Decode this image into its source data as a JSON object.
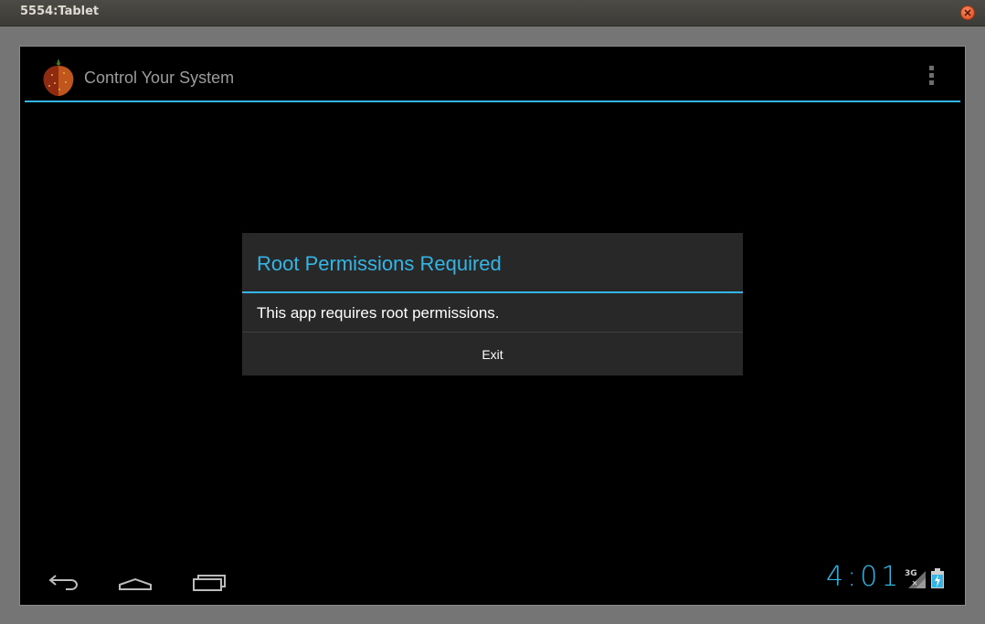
{
  "window": {
    "title": "5554:Tablet"
  },
  "app": {
    "title": "Control Your System",
    "icon": "strawberry-icon"
  },
  "dialog": {
    "title": "Root Permissions Required",
    "message": "This app requires root permissions.",
    "button_label": "Exit"
  },
  "status": {
    "time": "4:01",
    "network": "3G"
  },
  "colors": {
    "accent": "#33b5e5",
    "dialog_bg": "#282828",
    "screen_bg": "#000000"
  }
}
